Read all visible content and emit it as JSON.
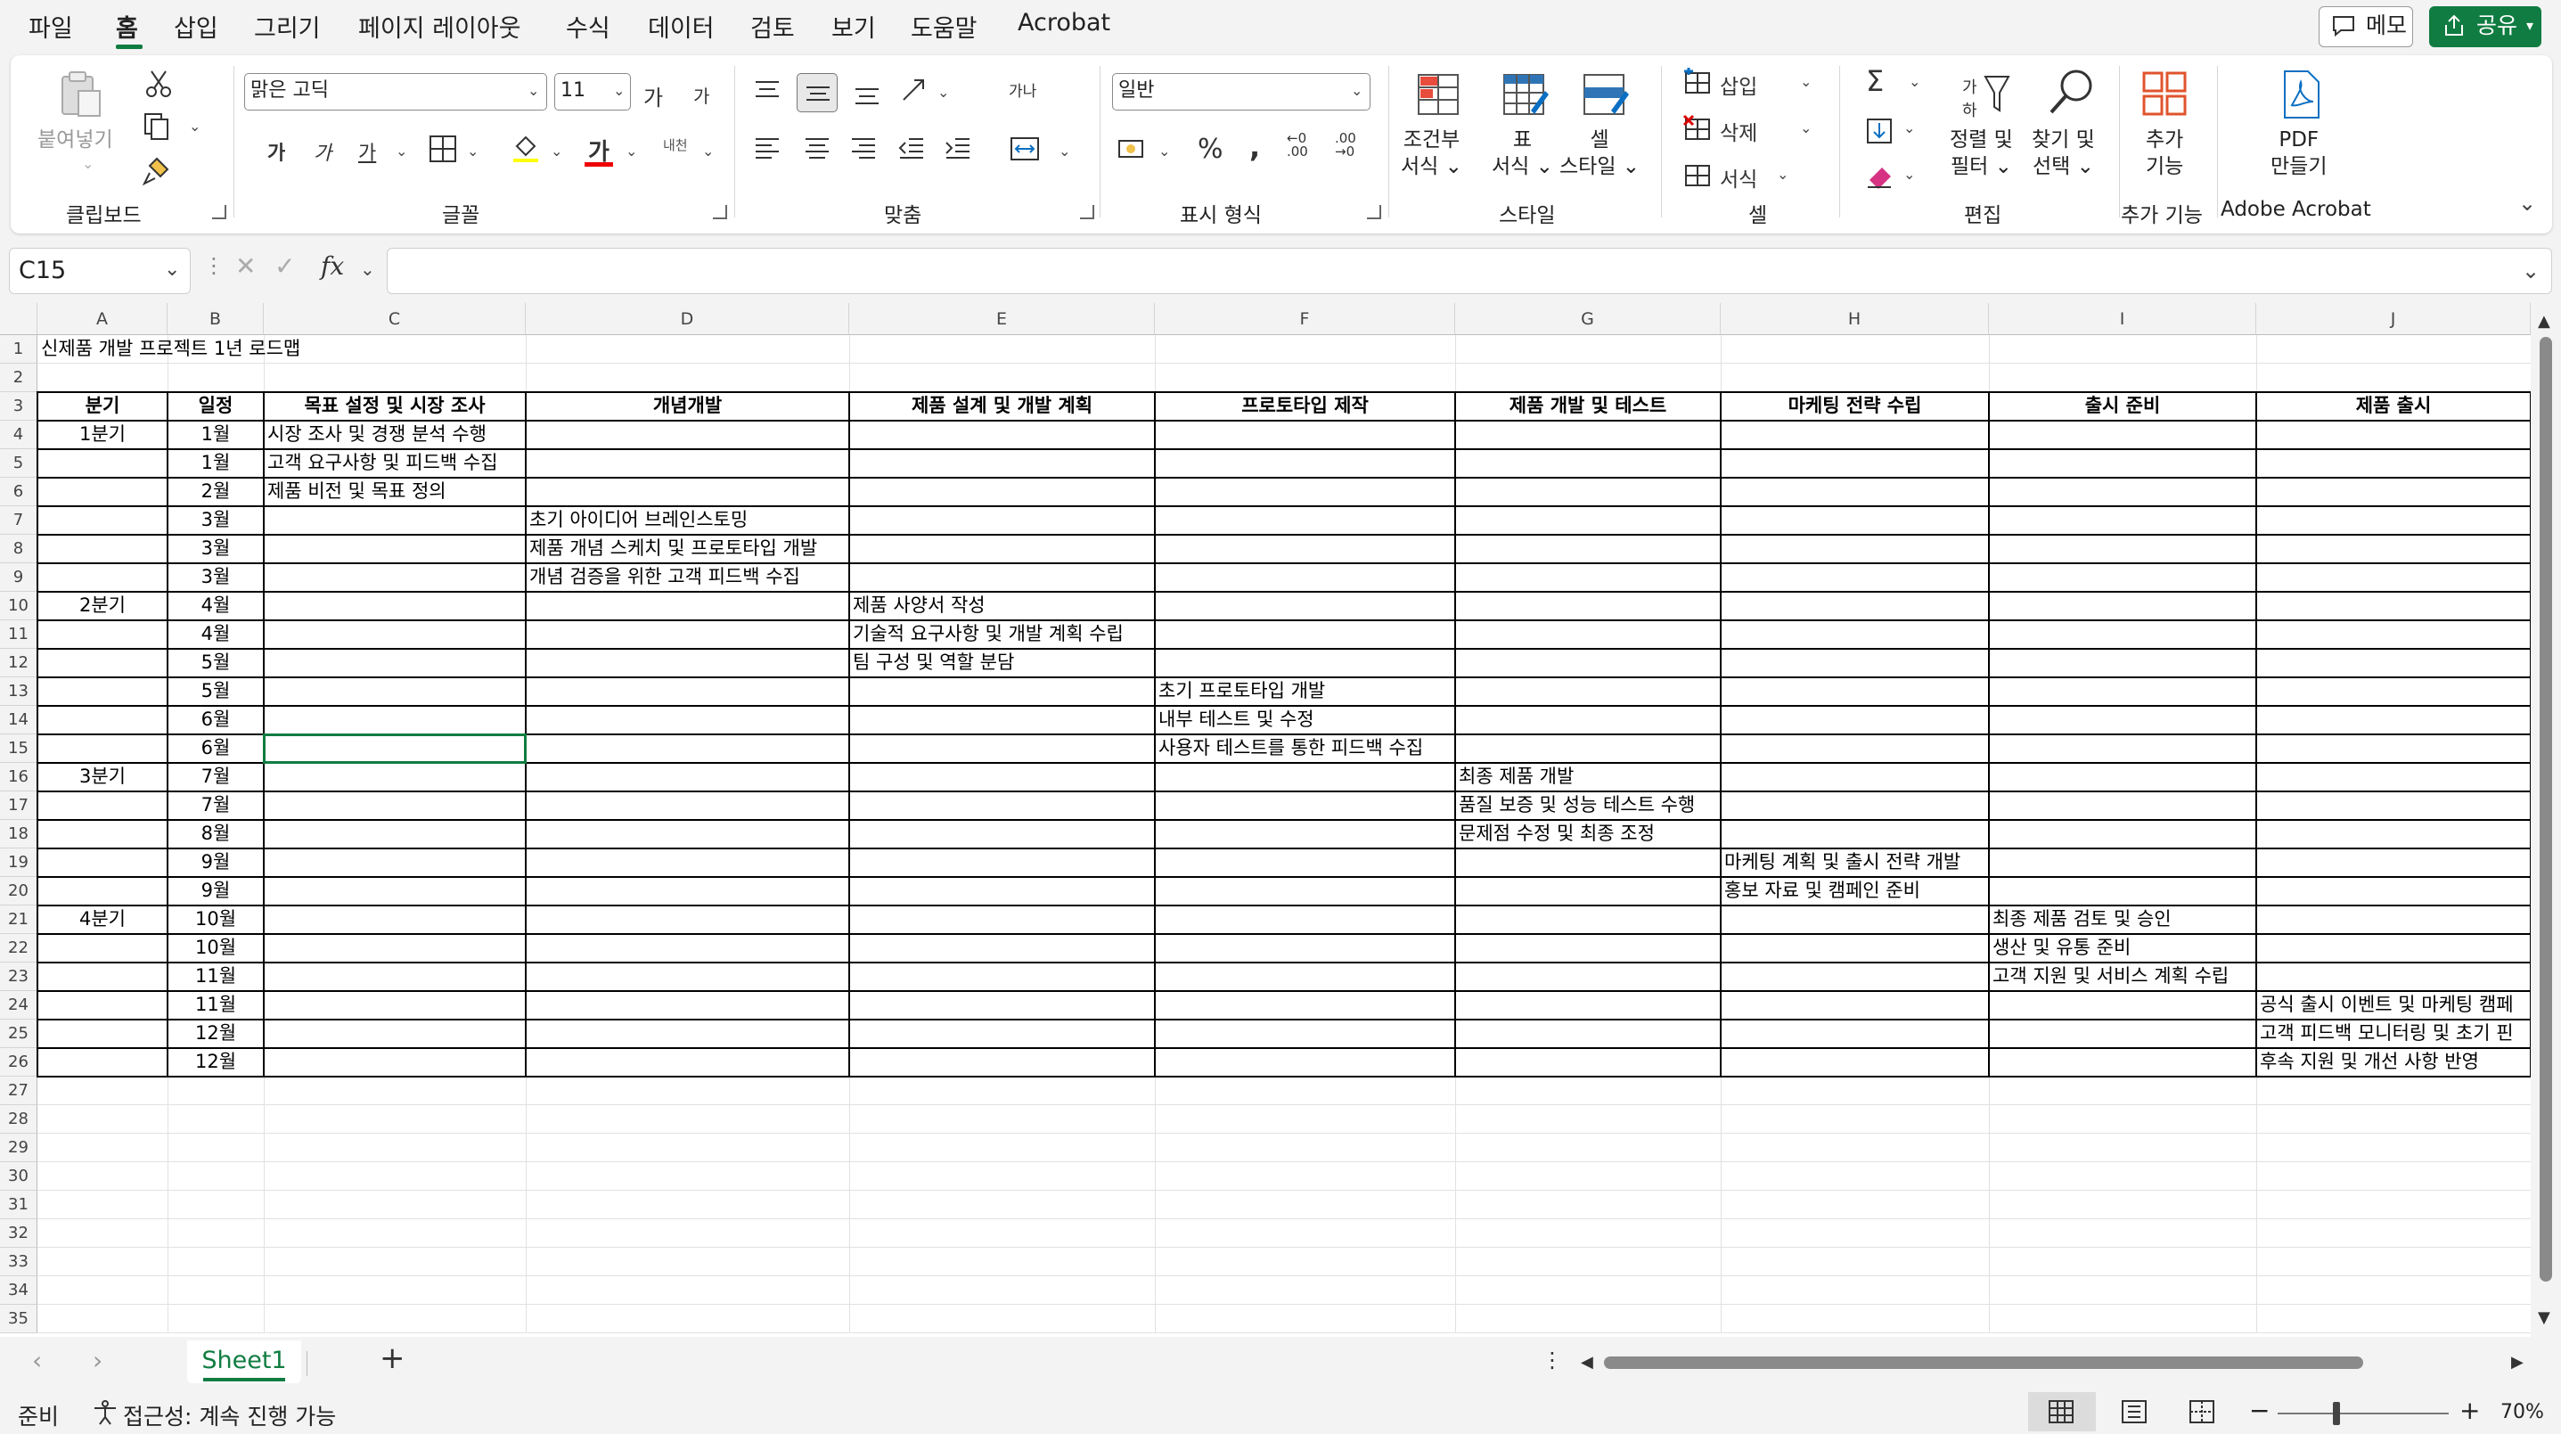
{
  "menu": {
    "items": [
      "파일",
      "홈",
      "삽입",
      "그리기",
      "페이지 레이아웃",
      "수식",
      "데이터",
      "검토",
      "보기",
      "도움말",
      "Acrobat"
    ],
    "comment_label": "메모",
    "share_label": "공유"
  },
  "ribbon": {
    "clipboard": {
      "paste_label": "붙여넣기",
      "group": "클립보드"
    },
    "font": {
      "name": "맑은 고딕",
      "size": "11",
      "grow": "가",
      "shrink": "가",
      "bold": "가",
      "italic": "가",
      "underline": "가",
      "color_glyph": "가",
      "phonetic": "내천",
      "group": "글꼴"
    },
    "align": {
      "group": "맞춤",
      "wrap_glyph": "가나"
    },
    "number": {
      "format": "일반",
      "group": "표시 형식"
    },
    "styles": {
      "conditional_1": "조건부",
      "conditional_2": "서식",
      "table_1": "표",
      "table_2": "서식",
      "cell_1": "셀",
      "cell_2": "스타일",
      "group": "스타일"
    },
    "cells": {
      "insert": "삽입",
      "delete": "삭제",
      "format": "서식",
      "group": "셀"
    },
    "editing": {
      "sort_1": "정렬 및",
      "sort_2": "필터",
      "find_1": "찾기 및",
      "find_2": "선택",
      "group": "편집"
    },
    "addins": {
      "label_1": "추가",
      "label_2": "기능",
      "group": "추가 기능"
    },
    "acrobat": {
      "label_1": "PDF",
      "label_2": "만들기",
      "group": "Adobe Acrobat"
    }
  },
  "formula_bar": {
    "name_box": "C15",
    "fx": "fx",
    "value": ""
  },
  "columns": [
    "A",
    "B",
    "C",
    "D",
    "E",
    "F",
    "G",
    "H",
    "I",
    "J"
  ],
  "rows": [
    "1",
    "2",
    "3",
    "4",
    "5",
    "6",
    "7",
    "8",
    "9",
    "10",
    "11",
    "12",
    "13",
    "14",
    "15",
    "16",
    "17",
    "18",
    "19",
    "20",
    "21",
    "22",
    "23",
    "24",
    "25",
    "26",
    "27",
    "28",
    "29",
    "30",
    "31",
    "32",
    "33",
    "34",
    "35"
  ],
  "sheet": {
    "title": "신제품 개발 프로젝트 1년 로드맵",
    "headers": [
      "분기",
      "일정",
      "목표 설정 및 시장 조사",
      "개념개발",
      "제품 설계 및 개발 계획",
      "프로토타입 제작",
      "제품 개발 및 테스트",
      "마케팅 전략 수립",
      "출시 준비",
      "제품 출시"
    ],
    "quarters": [
      "1분기",
      "",
      "",
      "",
      "",
      "",
      "2분기",
      "",
      "",
      "",
      "",
      "",
      "3분기",
      "",
      "",
      "",
      "",
      "4분기",
      "",
      "",
      "",
      "",
      ""
    ],
    "months": [
      "1월",
      "1월",
      "2월",
      "3월",
      "3월",
      "3월",
      "4월",
      "4월",
      "5월",
      "5월",
      "6월",
      "6월",
      "7월",
      "7월",
      "8월",
      "9월",
      "9월",
      "10월",
      "10월",
      "11월",
      "11월",
      "12월",
      "12월"
    ],
    "tasks": [
      {
        "row": 4,
        "col": 2,
        "text": "시장 조사 및 경쟁 분석 수행"
      },
      {
        "row": 5,
        "col": 2,
        "text": "고객 요구사항 및 피드백 수집"
      },
      {
        "row": 6,
        "col": 2,
        "text": "제품 비전 및 목표 정의"
      },
      {
        "row": 7,
        "col": 3,
        "text": "초기 아이디어 브레인스토밍"
      },
      {
        "row": 8,
        "col": 3,
        "text": "제품 개념 스케치 및 프로토타입 개발"
      },
      {
        "row": 9,
        "col": 3,
        "text": "개념 검증을 위한 고객 피드백 수집"
      },
      {
        "row": 10,
        "col": 4,
        "text": "제품 사양서 작성"
      },
      {
        "row": 11,
        "col": 4,
        "text": "기술적 요구사항 및 개발 계획 수립"
      },
      {
        "row": 12,
        "col": 4,
        "text": "팀 구성 및 역할 분담"
      },
      {
        "row": 13,
        "col": 5,
        "text": "초기 프로토타입 개발"
      },
      {
        "row": 14,
        "col": 5,
        "text": "내부 테스트 및 수정"
      },
      {
        "row": 15,
        "col": 5,
        "text": "사용자 테스트를 통한 피드백 수집"
      },
      {
        "row": 16,
        "col": 6,
        "text": "최종 제품 개발"
      },
      {
        "row": 17,
        "col": 6,
        "text": "품질 보증 및 성능 테스트 수행"
      },
      {
        "row": 18,
        "col": 6,
        "text": "문제점 수정 및 최종 조정"
      },
      {
        "row": 19,
        "col": 7,
        "text": "마케팅 계획 및 출시 전략 개발"
      },
      {
        "row": 20,
        "col": 7,
        "text": "홍보 자료 및 캠페인 준비"
      },
      {
        "row": 21,
        "col": 8,
        "text": "최종 제품 검토 및 승인"
      },
      {
        "row": 22,
        "col": 8,
        "text": "생산 및 유통 준비"
      },
      {
        "row": 23,
        "col": 8,
        "text": "고객 지원 및 서비스 계획 수립"
      },
      {
        "row": 24,
        "col": 9,
        "text": "공식 출시 이벤트 및 마케팅 캠페"
      },
      {
        "row": 25,
        "col": 9,
        "text": "고객 피드백 모니터링 및 초기 핀"
      },
      {
        "row": 26,
        "col": 9,
        "text": "후속 지원 및 개선 사항 반영"
      }
    ]
  },
  "tabs": {
    "sheet_name": "Sheet1",
    "add": "+"
  },
  "status": {
    "ready": "준비",
    "accessibility": "접근성: 계속 진행 가능",
    "zoom": "70%",
    "minus": "−",
    "plus": "+"
  }
}
